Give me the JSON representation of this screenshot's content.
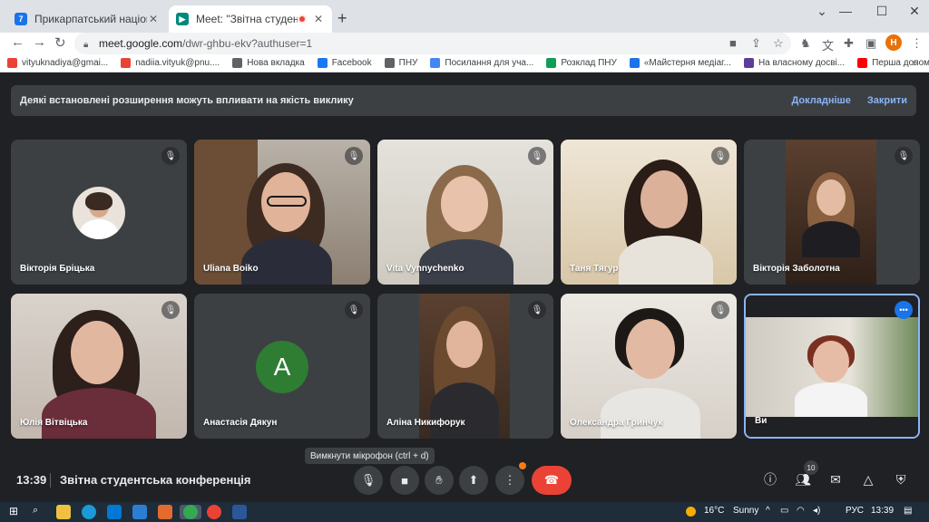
{
  "browser": {
    "tabs": [
      {
        "title": "Прикарпатський національний",
        "active": false
      },
      {
        "title": "Meet: \"Звітна студентська к",
        "active": true
      }
    ],
    "url_host": "meet.google.com",
    "url_path": "/dwr-ghbu-ekv?authuser=1",
    "profile_initial": "H",
    "bookmarks": [
      {
        "label": "vityuknadiya@gmai...",
        "color": "#ea4335"
      },
      {
        "label": "nadiia.vityuk@pnu....",
        "color": "#ea4335"
      },
      {
        "label": "Нова вкладка",
        "color": "#5f6368"
      },
      {
        "label": "Facebook",
        "color": "#1877f2"
      },
      {
        "label": "ПНУ",
        "color": "#5f6368"
      },
      {
        "label": "Посилання для уча...",
        "color": "#4285f4"
      },
      {
        "label": "Розклад ПНУ",
        "color": "#0f9d58"
      },
      {
        "label": "«Майстерня медіаг...",
        "color": "#1a73e8"
      },
      {
        "label": "На власному досві...",
        "color": "#5c3d99"
      },
      {
        "label": "Перша допомога -...",
        "color": "#ff0000"
      }
    ],
    "bookmarks_more": "»"
  },
  "banner": {
    "message": "Деякі встановлені розширення можуть впливати на якість виклику",
    "details": "Докладніше",
    "close": "Закрити"
  },
  "participants": [
    {
      "name": "Вікторія Бріцька"
    },
    {
      "name": "Uliana Boiko"
    },
    {
      "name": "Vita Vynnychenko"
    },
    {
      "name": "Таня Тягур"
    },
    {
      "name": "Вікторія Заболотна"
    },
    {
      "name": "Юлія Вітвіцька"
    },
    {
      "name": "Анастасія Дякун",
      "initial": "A"
    },
    {
      "name": "Аліна Никифорук"
    },
    {
      "name": "Олександра Гринчук"
    },
    {
      "name": "Ви"
    }
  ],
  "tooltip": "Вимкнути мікрофон (ctrl + d)",
  "meeting": {
    "time": "13:39",
    "title": "Звітна студентська конференція",
    "participant_count": "10"
  },
  "taskbar": {
    "temperature": "16°C",
    "weather": "Sunny",
    "language": "РУС",
    "time": "13:39"
  },
  "colors": {
    "meet_bg": "#202124",
    "tile_bg": "#3c4043",
    "end_call": "#ea4335",
    "accent": "#8ab4f8"
  }
}
